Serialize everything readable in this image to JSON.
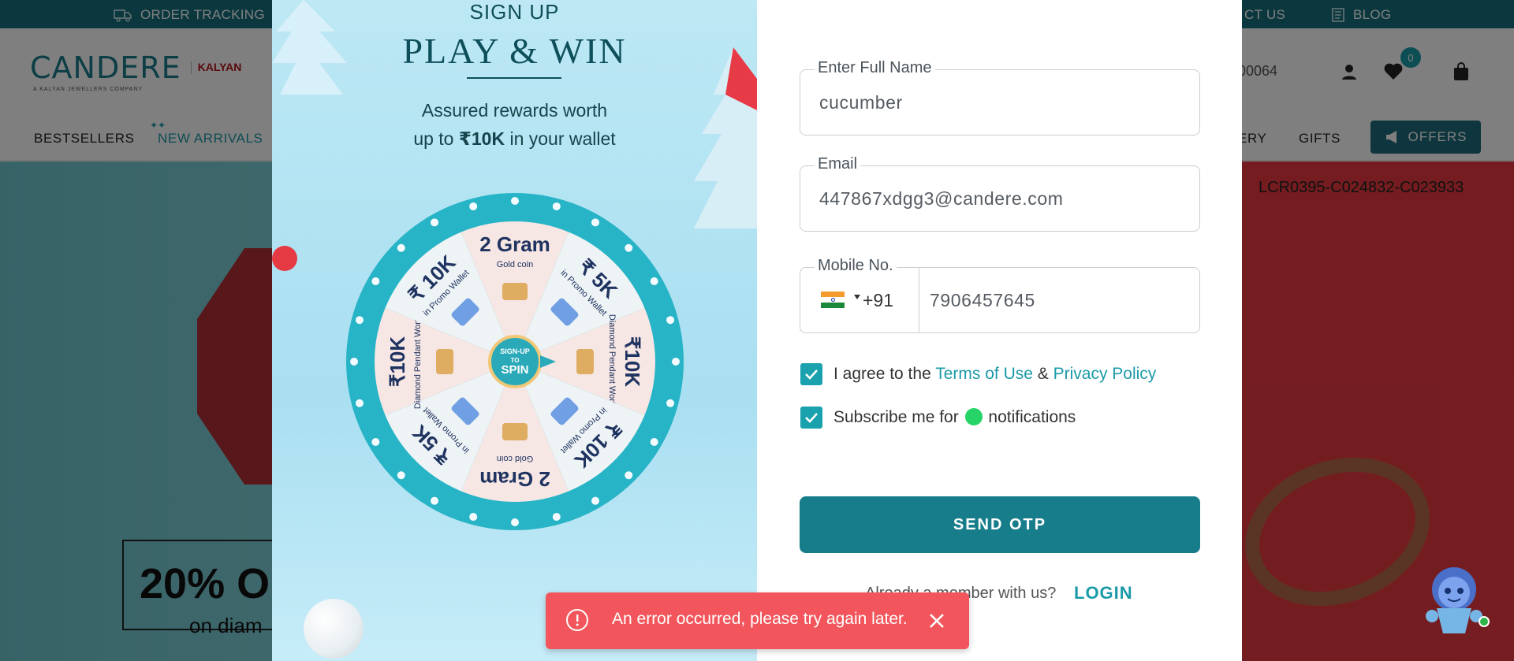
{
  "topbar": {
    "order_tracking": "ORDER TRACKING",
    "contact": "CT US",
    "blog": "BLOG"
  },
  "header": {
    "logo": "CANDERE",
    "logo_sub": "A KALYAN JEWELLERS COMPANY",
    "partner": "KALYAN",
    "phone": "400064",
    "wishlist_count": "0"
  },
  "nav": {
    "bestsellers": "BESTSELLERS",
    "new_arrivals": "NEW ARRIVALS",
    "jewellery": "ERY",
    "gifts": "GIFTS",
    "offers": "OFFERS"
  },
  "hero": {
    "sku": "LCR0395-C024832-C023933",
    "promo": "20% O",
    "promo_sub": "on diam"
  },
  "modal": {
    "sign_up": "SIGN UP",
    "title": "PLAY & WIN",
    "assured_line1": "Assured rewards worth",
    "assured_pre": "up to ",
    "assured_amount": "₹10K",
    "assured_post": " in your wallet",
    "wheel": {
      "segments": [
        {
          "big": "2 Gram",
          "small": "Gold coin"
        },
        {
          "big": "₹ 5K",
          "small": "in Promo Wallet"
        },
        {
          "big": "₹10K",
          "small": "Diamond Pendant Worth"
        },
        {
          "big": "₹ 10K",
          "small": "in Promo Wallet"
        },
        {
          "big": "2 Gram",
          "small": "Gold coin"
        },
        {
          "big": "₹ 5K",
          "small": "in Promo Wallet"
        },
        {
          "big": "₹10K",
          "small": "Diamond Pendant Worth"
        },
        {
          "big": "₹ 10K",
          "small": "in Promo Wallet"
        }
      ],
      "center_line1": "SIGN-UP",
      "center_line2": "TO",
      "center_line3": "SPIN"
    }
  },
  "form": {
    "name_label": "Enter Full Name",
    "name_value": "cucumber",
    "email_label": "Email",
    "email_value": "447867xdgg3@candere.com",
    "mobile_label": "Mobile No.",
    "dial_code": "+91",
    "mobile_value": "7906457645",
    "terms_pre": "I agree to the ",
    "terms_link": "Terms of Use",
    "terms_amp": " & ",
    "privacy_link": "Privacy Policy",
    "subscribe_pre": "Subscribe me for ",
    "subscribe_post": " notifications",
    "send_otp": "SEND OTP",
    "member_text": "Already a member with us?",
    "login": "LOGIN"
  },
  "toast": {
    "message": "An error occurred, please try again later."
  },
  "colors": {
    "brand": "#177d8b",
    "accent": "#1b9aa8",
    "error": "#f2565c"
  }
}
